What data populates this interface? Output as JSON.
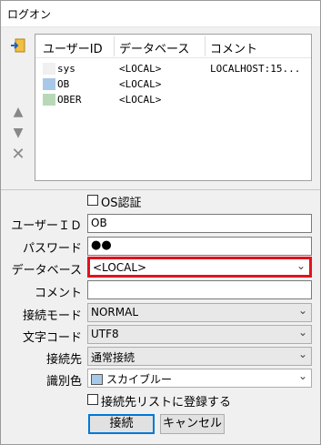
{
  "window": {
    "title": "ログオン"
  },
  "list": {
    "columns": [
      "ユーザーID",
      "データベース",
      "コメント"
    ],
    "rows": [
      {
        "user": "sys",
        "db": "<LOCAL>",
        "comment": "LOCALHOST:15...",
        "color": "#f0f0f0"
      },
      {
        "user": "OB",
        "db": "<LOCAL>",
        "comment": "",
        "color": "#a8c8e8"
      },
      {
        "user": "OBER",
        "db": "<LOCAL>",
        "comment": "",
        "color": "#b8d8b8"
      }
    ]
  },
  "form": {
    "os_auth_label": "OS認証",
    "user_id_label": "ユーザーＩＤ",
    "user_id_value": "OB",
    "password_label": "パスワード",
    "password_value": "●●",
    "database_label": "データベース",
    "database_value": "<LOCAL>",
    "comment_label": "コメント",
    "comment_value": "",
    "conn_mode_label": "接続モード",
    "conn_mode_value": "NORMAL",
    "charset_label": "文字コード",
    "charset_value": "UTF8",
    "destination_label": "接続先",
    "destination_value": "通常接続",
    "color_label": "識別色",
    "color_value": "スカイブルー",
    "color_swatch": "#a8c8e8",
    "register_label": "接続先リストに登録する"
  },
  "buttons": {
    "connect": "接続",
    "cancel": "キャンセル"
  }
}
